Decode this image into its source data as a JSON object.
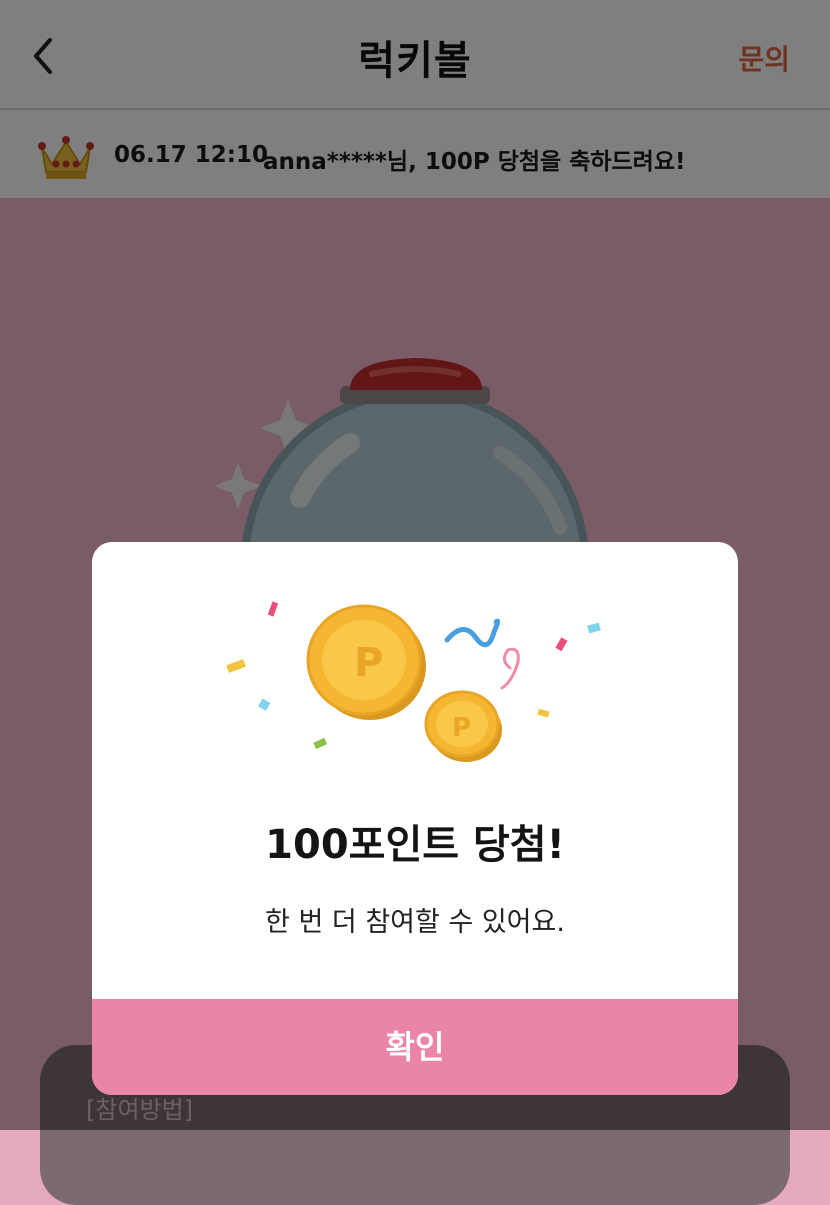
{
  "header": {
    "title": "럭키볼",
    "back_icon": "chevron-left-icon",
    "inquiry_label": "문의"
  },
  "ticker": {
    "icon": "crown-icon",
    "time": "06.17 12:10",
    "message": "anna*****님, 100P 당첨을 축하드려요!"
  },
  "background": {
    "method_label": "[참여방법]"
  },
  "dialog": {
    "illustration_icons": [
      "coin-icon",
      "confetti-icon"
    ],
    "coin_letter": "P",
    "title": "100포인트 당첨!",
    "message": "한 번 더 참여할 수 있어요.",
    "confirm_label": "확인"
  },
  "colors": {
    "accent": "#ea85a8",
    "inquiry": "#e0663e",
    "coin": "#f5b731"
  }
}
